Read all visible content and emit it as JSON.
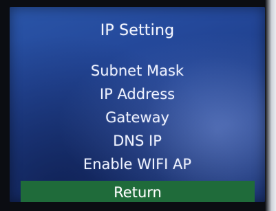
{
  "screen": {
    "title": "IP Setting",
    "menu_items": [
      {
        "label": "Subnet Mask"
      },
      {
        "label": "IP Address"
      },
      {
        "label": "Gateway"
      },
      {
        "label": "DNS IP"
      },
      {
        "label": "Enable WIFI AP"
      },
      {
        "label": "Return",
        "selected": true
      }
    ]
  },
  "colors": {
    "screen_background": "#24489a",
    "text": "#eef2ff",
    "selection_bar": "#1f6b3a"
  }
}
